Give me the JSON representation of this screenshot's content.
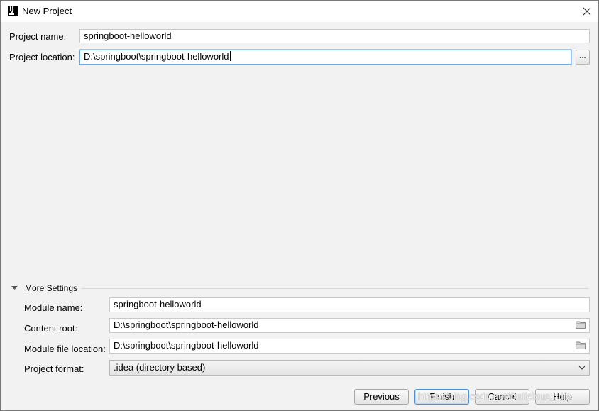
{
  "window": {
    "title": "New Project"
  },
  "project": {
    "name_label": "Project name:",
    "name_value": "springboot-helloworld",
    "location_label": "Project location:",
    "location_value": "D:\\springboot\\springboot-helloworld",
    "browse_label": "..."
  },
  "more_settings": {
    "label": "More Settings",
    "module_name_label": "Module name:",
    "module_name_value": "springboot-helloworld",
    "content_root_label": "Content root:",
    "content_root_value": "D:\\springboot\\springboot-helloworld",
    "module_file_label": "Module file location:",
    "module_file_value": "D:\\springboot\\springboot-helloworld",
    "format_label": "Project format:",
    "format_value": ".idea (directory based)"
  },
  "buttons": {
    "previous": "Previous",
    "finish": "Finish",
    "cancel": "Cancel",
    "help": "Help"
  },
  "watermark": "https://blog.csdn.net/Delicious_Life",
  "colors": {
    "focus_border": "#6fa8dc",
    "dialog_bg": "#f2f2f2"
  }
}
